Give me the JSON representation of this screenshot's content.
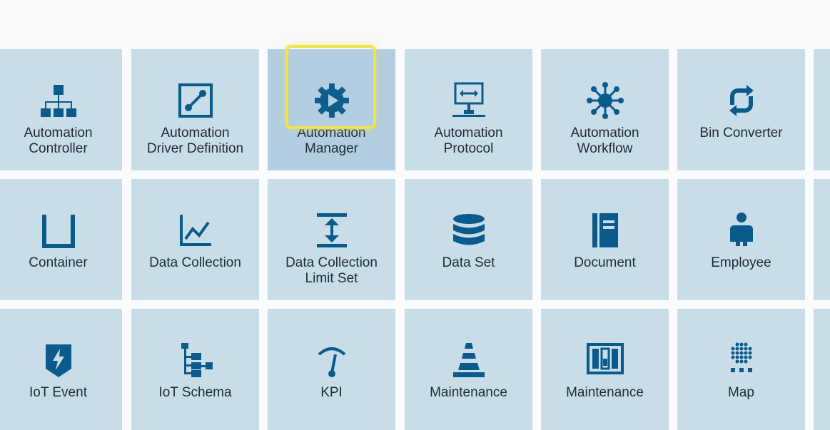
{
  "tiles": [
    {
      "label": "Automation\nController",
      "icon": "hierarchy-icon"
    },
    {
      "label": "Automation\nDriver Definition",
      "icon": "connector-icon"
    },
    {
      "label": "Automation\nManager",
      "icon": "gear-play-icon"
    },
    {
      "label": "Automation\nProtocol",
      "icon": "monitor-network-icon"
    },
    {
      "label": "Automation\nWorkflow",
      "icon": "workflow-network-icon"
    },
    {
      "label": "Bin Converter",
      "icon": "refresh-icon"
    },
    {
      "label": "Container",
      "icon": "container-icon"
    },
    {
      "label": "Data Collection",
      "icon": "line-chart-icon"
    },
    {
      "label": "Data Collection\nLimit Set",
      "icon": "limit-set-icon"
    },
    {
      "label": "Data Set",
      "icon": "database-icon"
    },
    {
      "label": "Document",
      "icon": "document-icon"
    },
    {
      "label": "Employee",
      "icon": "employee-icon"
    },
    {
      "label": "IoT Event",
      "icon": "iot-event-icon"
    },
    {
      "label": "IoT Schema",
      "icon": "schema-tree-icon"
    },
    {
      "label": "KPI",
      "icon": "gauge-icon"
    },
    {
      "label": "Maintenance",
      "icon": "traffic-cone-icon"
    },
    {
      "label": "Maintenance",
      "icon": "maintenance-panel-icon"
    },
    {
      "label": "Map",
      "icon": "map-grid-icon"
    }
  ],
  "colors": {
    "tile_background": "#c9dde8",
    "tile_selected_background": "#b2cee0",
    "icon_blue": "#0b5a8c",
    "highlight_yellow": "#f2e249",
    "text": "#1f2a35"
  }
}
